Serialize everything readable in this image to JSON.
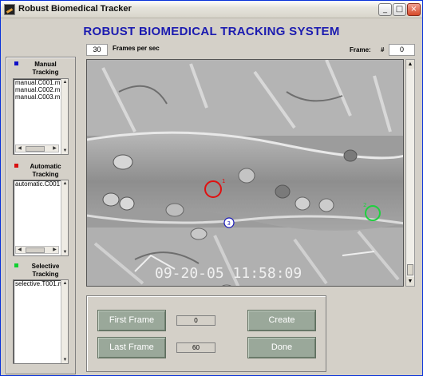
{
  "window": {
    "title": "Robust Biomedical Tracker",
    "controls": [
      "_",
      "□",
      "×"
    ]
  },
  "header": {
    "title": "ROBUST BIOMEDICAL TRACKING SYSTEM"
  },
  "playback": {
    "fps_value": "30",
    "fps_label": "Frames per sec",
    "frame_label": "Frame:",
    "hash_label": "#",
    "frame_value": "0"
  },
  "sidebar": {
    "manual": {
      "label": "Manual Tracking",
      "color": "#1010c8",
      "items": [
        "manual.C001.m",
        "manual.C002.m",
        "manual.C003.m"
      ]
    },
    "automatic": {
      "label": "Automatic Tracking",
      "color": "#d81010",
      "items": [
        "automatic.C001"
      ]
    },
    "selective": {
      "label": "Selective Tracking",
      "color": "#10d030",
      "items": [
        "selective.T001.m"
      ]
    }
  },
  "viewer": {
    "timestamp": "09-20-05 11:58:09",
    "markers": [
      {
        "label": "1",
        "color": "#e01010"
      },
      {
        "label": "2",
        "color": "#20d040"
      },
      {
        "label": "3",
        "color": "#1a1ab8"
      }
    ]
  },
  "controls": {
    "first_frame_label": "First Frame",
    "first_frame_value": "0",
    "last_frame_label": "Last Frame",
    "last_frame_value": "60",
    "create_label": "Create",
    "done_label": "Done"
  }
}
